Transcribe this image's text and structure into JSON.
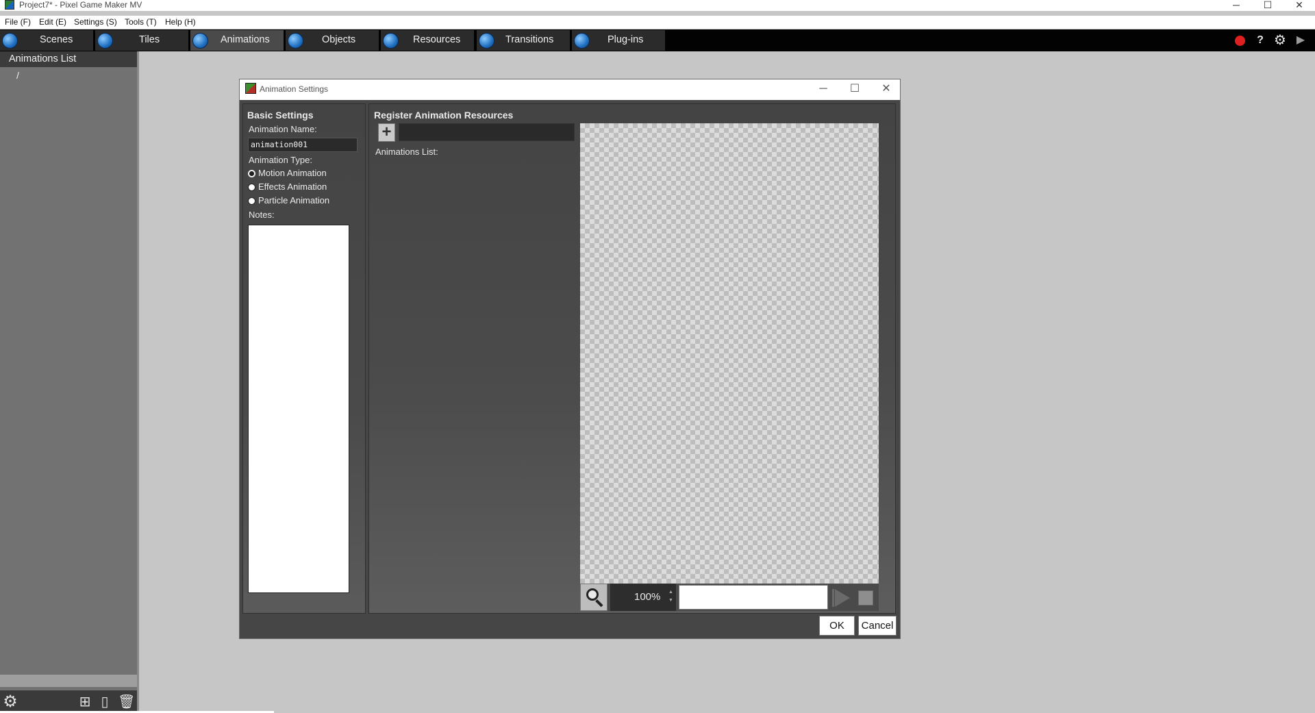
{
  "window": {
    "title": "Project7* - Pixel Game Maker MV",
    "controls": {
      "minimize": "─",
      "maximize": "☐",
      "close": "✕"
    }
  },
  "menubar": {
    "items": [
      "File (F)",
      "Edit (E)",
      "Settings (S)",
      "Tools (T)",
      "Help (H)"
    ]
  },
  "toolbar": {
    "tabs": [
      {
        "label": "Scenes",
        "icon": "scenes-icon"
      },
      {
        "label": "Tiles",
        "icon": "tiles-icon"
      },
      {
        "label": "Animations",
        "icon": "animations-icon",
        "active": true
      },
      {
        "label": "Objects",
        "icon": "objects-icon"
      },
      {
        "label": "Resources",
        "icon": "resources-icon"
      },
      {
        "label": "Transitions",
        "icon": "transitions-icon"
      },
      {
        "label": "Plug-ins",
        "icon": "plugins-icon"
      }
    ],
    "right_icons": {
      "record": "record-icon",
      "help": "?",
      "settings": "gear-icon",
      "play": "▶"
    }
  },
  "left_panel": {
    "header": "Animations List",
    "root_item": "/"
  },
  "dialog": {
    "title": "Animation Settings",
    "basic": {
      "title": "Basic Settings",
      "name_label": "Animation Name:",
      "name_value": "animation001",
      "type_label": "Animation Type:",
      "types": [
        "Motion Animation",
        "Effects Animation",
        "Particle Animation"
      ],
      "selected_type": "Motion Animation",
      "notes_label": "Notes:",
      "notes_value": ""
    },
    "register": {
      "title": "Register Animation Resources",
      "list_label": "Animations List:",
      "zoom": "100%"
    },
    "ok_label": "OK",
    "cancel_label": "Cancel"
  },
  "colors": {
    "toolbar_bg": "#020202",
    "active_tab": "#4a4a4a",
    "workspace_bg": "#c6c6c6",
    "panel_bg": "#464646"
  }
}
